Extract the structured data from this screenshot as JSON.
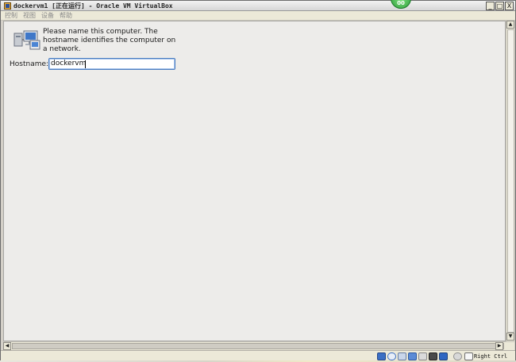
{
  "window": {
    "title": "dockervm1 [正在运行] - Oracle VM VirtualBox",
    "controls": [
      "_",
      "□",
      "X"
    ]
  },
  "menubar": {
    "items": [
      "控制",
      "视图",
      "设备",
      "帮助"
    ]
  },
  "badge": {
    "label": "00"
  },
  "guest": {
    "instructions": "Please name this computer.  The hostname identifies the computer on a network.",
    "hostname_label": "Hostname:",
    "hostname_value": "dockervm"
  },
  "statusbar": {
    "host_key": "Right Ctrl"
  },
  "colors": {
    "guest_background": "#edecea",
    "input_border": "#4a7cc0",
    "badge_green": "#2e9e3a"
  }
}
